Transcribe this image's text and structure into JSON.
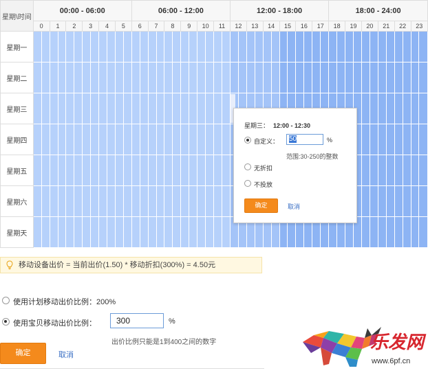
{
  "schedule": {
    "corner_label": "星期\\时间",
    "blocks": [
      "00:00 - 06:00",
      "06:00 - 12:00",
      "12:00 - 18:00",
      "18:00 - 24:00"
    ],
    "hours": [
      "0",
      "1",
      "2",
      "3",
      "4",
      "5",
      "6",
      "7",
      "8",
      "9",
      "10",
      "11",
      "12",
      "13",
      "14",
      "15",
      "16",
      "17",
      "18",
      "19",
      "20",
      "21",
      "22",
      "23"
    ],
    "days": [
      "星期一",
      "星期二",
      "星期三",
      "星期四",
      "星期五",
      "星期六",
      "星期天"
    ],
    "colors": {
      "light": "#b6d1fb",
      "mid": "#a4c4f8",
      "dark": "#8db4f4"
    }
  },
  "popup": {
    "day": "星期三：",
    "time_range": "12:00 - 12:30",
    "custom_label": "自定义：",
    "custom_value": "50",
    "percent": "%",
    "range_hint": "范围:30-250的整数",
    "no_discount_label": "无折扣",
    "no_bid_label": "不投放",
    "confirm_label": "确定",
    "cancel_label": "取消"
  },
  "tip": {
    "text": "移动设备出价 = 当前出价(1.50) * 移动折扣(300%) = 4.50元"
  },
  "options": {
    "plan_ratio_label": "使用计划移动出价比例：200%",
    "item_ratio_label": "使用宝贝移动出价比例：",
    "item_ratio_value": "300",
    "percent": "%",
    "hint": "出价比例只能是1到400之间的数字",
    "confirm_label": "确定",
    "cancel_label": "取消"
  },
  "watermark": {
    "brand": "乐发网",
    "url": "www.6pf.cn"
  }
}
